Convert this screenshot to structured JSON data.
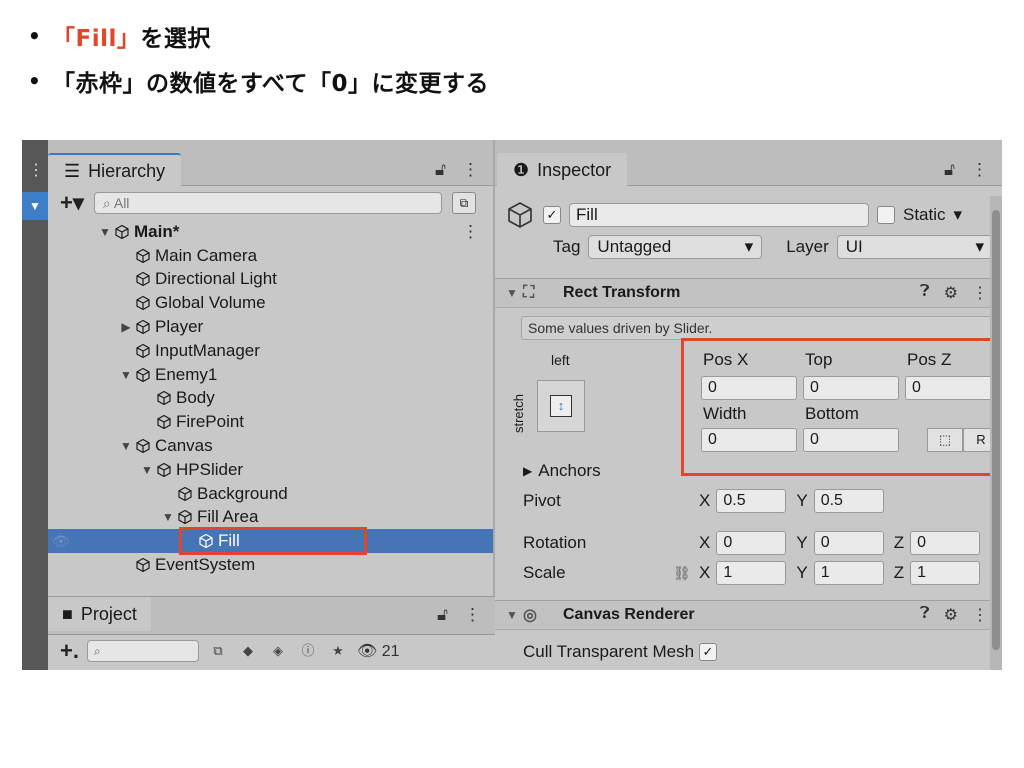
{
  "bullets": {
    "dot": "•",
    "line1_highlight": "「Fill」",
    "line1_rest": "を選択",
    "line2": "「赤枠」の数値をすべて「0」に変更する"
  },
  "hierarchy": {
    "title": "Hierarchy",
    "search_placeholder": "All",
    "items": [
      {
        "label": "Main*",
        "depth": 0,
        "arrow": "▼"
      },
      {
        "label": "Main Camera",
        "depth": 1,
        "arrow": ""
      },
      {
        "label": "Directional Light",
        "depth": 1,
        "arrow": ""
      },
      {
        "label": "Global Volume",
        "depth": 1,
        "arrow": ""
      },
      {
        "label": "Player",
        "depth": 1,
        "arrow": "▶"
      },
      {
        "label": "InputManager",
        "depth": 1,
        "arrow": ""
      },
      {
        "label": "Enemy1",
        "depth": 1,
        "arrow": "▼"
      },
      {
        "label": "Body",
        "depth": 2,
        "arrow": ""
      },
      {
        "label": "FirePoint",
        "depth": 2,
        "arrow": ""
      },
      {
        "label": "Canvas",
        "depth": 1,
        "arrow": "▼"
      },
      {
        "label": "HPSlider",
        "depth": 2,
        "arrow": "▼"
      },
      {
        "label": "Background",
        "depth": 3,
        "arrow": ""
      },
      {
        "label": "Fill Area",
        "depth": 3,
        "arrow": "▼"
      },
      {
        "label": "Fill",
        "depth": 4,
        "arrow": ""
      },
      {
        "label": "EventSystem",
        "depth": 1,
        "arrow": ""
      }
    ]
  },
  "project": {
    "title": "Project",
    "count": "21"
  },
  "inspector": {
    "title": "Inspector",
    "object_name": "Fill",
    "static_label": "Static",
    "tag_label": "Tag",
    "tag_value": "Untagged",
    "layer_label": "Layer",
    "layer_value": "UI",
    "rect_transform": "Rect Transform",
    "info": "Some values driven by Slider.",
    "anchor_left": "left",
    "anchor_stretch": "stretch",
    "posx_label": "Pos X",
    "top_label": "Top",
    "posz_label": "Pos Z",
    "posx": "0",
    "top": "0",
    "posz": "0",
    "width_label": "Width",
    "bottom_label": "Bottom",
    "width": "0",
    "bottom": "0",
    "r_button": "R",
    "anchors_label": "Anchors",
    "pivot_label": "Pivot",
    "pivot_x": "0.5",
    "pivot_y": "0.5",
    "rotation_label": "Rotation",
    "rot_x": "0",
    "rot_y": "0",
    "rot_z": "0",
    "scale_label": "Scale",
    "scale_x": "1",
    "scale_y": "1",
    "scale_z": "1",
    "canvas_renderer": "Canvas Renderer",
    "cull_label": "Cull Transparent Mesh"
  },
  "colors": {
    "highlight_red": "#e2462a",
    "selection_blue": "#4675b5"
  }
}
